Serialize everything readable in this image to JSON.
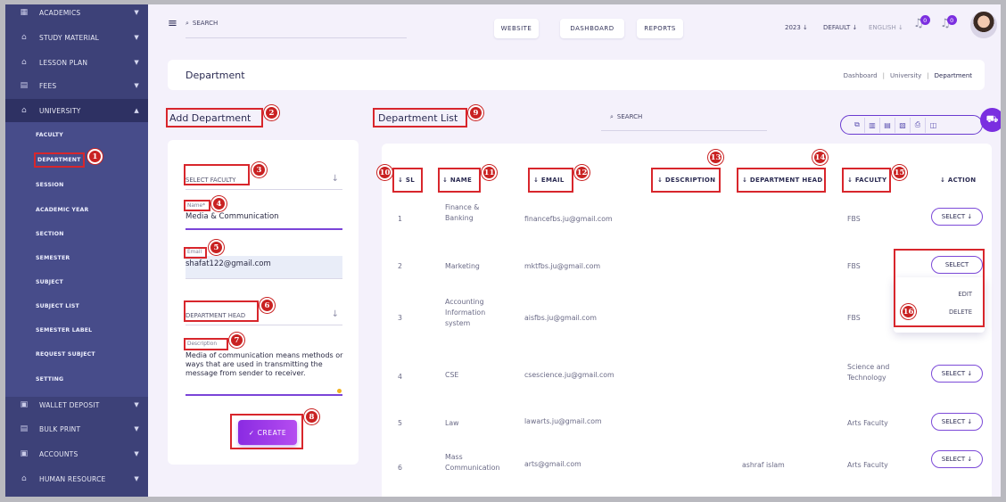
{
  "sidebar": {
    "items_top": [
      {
        "label": "ACADEMICS",
        "icon": "academics-icon"
      },
      {
        "label": "STUDY MATERIAL",
        "icon": "study-icon"
      },
      {
        "label": "LESSON PLAN",
        "icon": "lesson-icon"
      },
      {
        "label": "FEES",
        "icon": "fees-icon"
      },
      {
        "label": "UNIVERSITY",
        "icon": "university-icon"
      }
    ],
    "sub_items": [
      "FACULTY",
      "DEPARTMENT",
      "SESSION",
      "ACADEMIC YEAR",
      "SECTION",
      "SEMESTER",
      "SUBJECT",
      "SUBJECT LIST",
      "SEMESTER LABEL",
      "REQUEST SUBJECT",
      "SETTING"
    ],
    "items_bottom": [
      {
        "label": "WALLET DEPOSIT",
        "icon": "wallet-icon"
      },
      {
        "label": "BULK PRINT",
        "icon": "print-icon"
      },
      {
        "label": "ACCOUNTS",
        "icon": "accounts-icon"
      },
      {
        "label": "HUMAN RESOURCE",
        "icon": "hr-icon"
      }
    ]
  },
  "topbar": {
    "search_placeholder": "SEARCH",
    "nav": [
      "WEBSITE",
      "DASHBOARD",
      "REPORTS"
    ],
    "year": "2023",
    "default": "DEFAULT",
    "language": "ENGLISH",
    "notif_count_1": "0",
    "notif_count_2": "0"
  },
  "header": {
    "title": "Department",
    "breadcrumb": [
      "Dashboard",
      "University",
      "Department"
    ]
  },
  "form": {
    "title": "Add Department",
    "faculty_placeholder": "SELECT FACULTY",
    "name_label": "Name*",
    "name_value": "Media & Communication",
    "email_label": "Email",
    "email_value": "shafat122@gmail.com",
    "head_placeholder": "DEPARTMENT HEAD",
    "desc_label": "Description",
    "desc_value": "Media of communication means methods or ways that are used in transmitting the message from sender to receiver.",
    "create_label": "✓ CREATE"
  },
  "list": {
    "title": "Department List",
    "search_placeholder": "SEARCH",
    "columns": [
      "↓ SL",
      "↓ NAME",
      "↓ EMAIL",
      "↓ DESCRIPTION",
      "↓ DEPARTMENT HEAD",
      "↓ FACULTY",
      "↓ ACTION"
    ],
    "rows": [
      {
        "sl": "1",
        "name": "Finance & Banking",
        "email": "financefbs.ju@gmail.com",
        "description": "",
        "head": "",
        "faculty": "FBS",
        "action": "SELECT ↓"
      },
      {
        "sl": "2",
        "name": "Marketing",
        "email": "mktfbs.ju@gmail.com",
        "description": "",
        "head": "",
        "faculty": "FBS",
        "action": "SELECT"
      },
      {
        "sl": "3",
        "name": "Accounting Information system",
        "email": "aisfbs.ju@gmail.com",
        "description": "",
        "head": "",
        "faculty": "FBS",
        "action": ""
      },
      {
        "sl": "4",
        "name": "CSE",
        "email": "csescience.ju@gmail.com",
        "description": "",
        "head": "",
        "faculty": "Science and Technology",
        "action": "SELECT ↓"
      },
      {
        "sl": "5",
        "name": "Law",
        "email": "lawarts.ju@gmail.com",
        "description": "",
        "head": "",
        "faculty": "Arts Faculty",
        "action": "SELECT ↓"
      },
      {
        "sl": "6",
        "name": "Mass Communication",
        "email": "arts@gmail.com",
        "description": "",
        "head": "ashraf islam",
        "faculty": "Arts Faculty",
        "action": "SELECT ↓"
      }
    ],
    "dropdown": [
      "EDIT",
      "DELETE"
    ]
  },
  "badges": [
    "1",
    "2",
    "3",
    "4",
    "5",
    "6",
    "7",
    "8",
    "9",
    "10",
    "11",
    "12",
    "13",
    "14",
    "15",
    "16"
  ],
  "colors": {
    "sidebar": "#3d4178",
    "accent": "#8a2be2",
    "annotation": "#d8262c"
  }
}
